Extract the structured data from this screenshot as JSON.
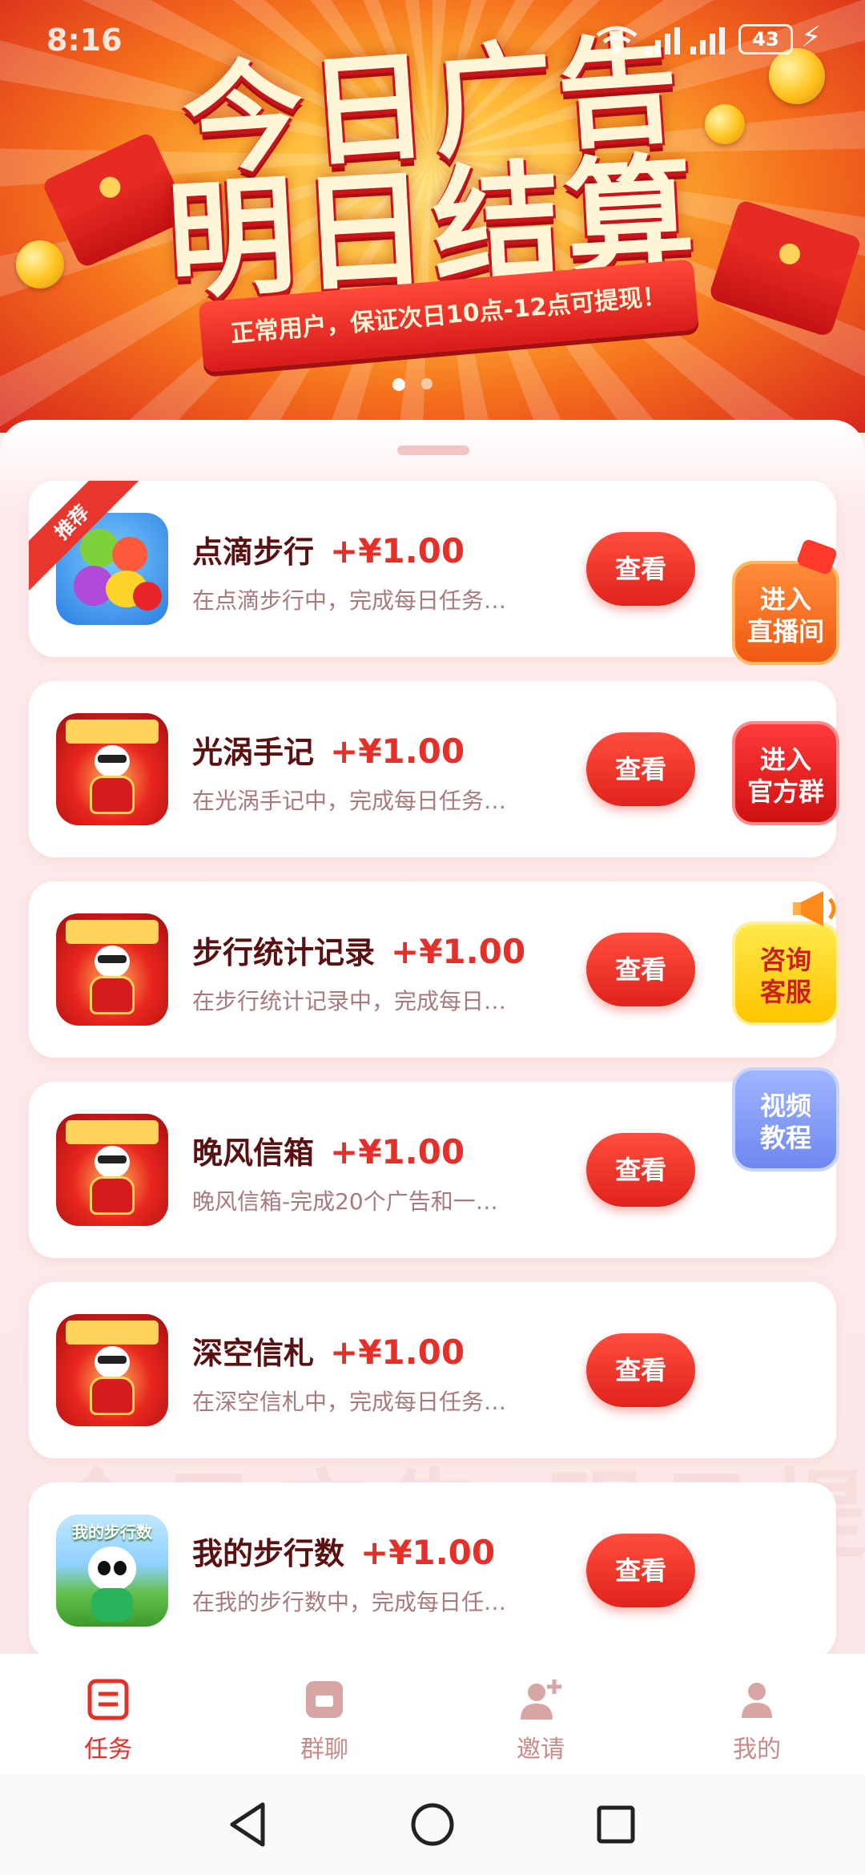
{
  "status_bar": {
    "time": "8:16",
    "battery": "43"
  },
  "banner": {
    "title_line1": "今日广告",
    "title_line2": "明日结算",
    "ribbon_text": "正常用户，保证次日10点-12点可提现！"
  },
  "tasks": [
    {
      "name": "点滴步行",
      "reward": "+¥1.00",
      "desc": "在点滴步行中，完成每日任务…",
      "button": "查看",
      "badge": "推荐",
      "icon": "fruit-icon"
    },
    {
      "name": "光涡手记",
      "reward": "+¥1.00",
      "desc": "在光涡手记中，完成每日任务…",
      "button": "查看",
      "icon": "panda-icon"
    },
    {
      "name": "步行统计记录",
      "reward": "+¥1.00",
      "desc": "在步行统计记录中，完成每日…",
      "button": "查看",
      "icon": "panda-icon"
    },
    {
      "name": "晚风信箱",
      "reward": "+¥1.00",
      "desc": "晚风信箱-完成20个广告和一…",
      "button": "查看",
      "icon": "panda-icon"
    },
    {
      "name": "深空信札",
      "reward": "+¥1.00",
      "desc": "在深空信札中，完成每日任务…",
      "button": "查看",
      "icon": "panda-icon"
    },
    {
      "name": "我的步行数",
      "reward": "+¥1.00",
      "desc": "在我的步行数中，完成每日任…",
      "button": "查看",
      "icon": "steps-icon",
      "icon_text": "我的步行数"
    }
  ],
  "float_buttons": {
    "live": {
      "line1": "进入",
      "line2": "直播间"
    },
    "group": {
      "line1": "进入",
      "line2": "官方群"
    },
    "service": {
      "line1": "咨询",
      "line2": "客服"
    },
    "video": {
      "line1": "视频",
      "line2": "教程"
    }
  },
  "watermark": "今日广告 明日提现",
  "bottom_nav": [
    {
      "label": "任务",
      "icon": "task-list-icon",
      "active": true
    },
    {
      "label": "群聊",
      "icon": "chat-icon",
      "active": false
    },
    {
      "label": "邀请",
      "icon": "invite-user-icon",
      "active": false
    },
    {
      "label": "我的",
      "icon": "profile-icon",
      "active": false
    }
  ],
  "colors": {
    "accent": "#e5302a",
    "title_text": "#5a1010",
    "desc_text": "#a87b7b",
    "nav_inactive": "#c98a8a"
  }
}
